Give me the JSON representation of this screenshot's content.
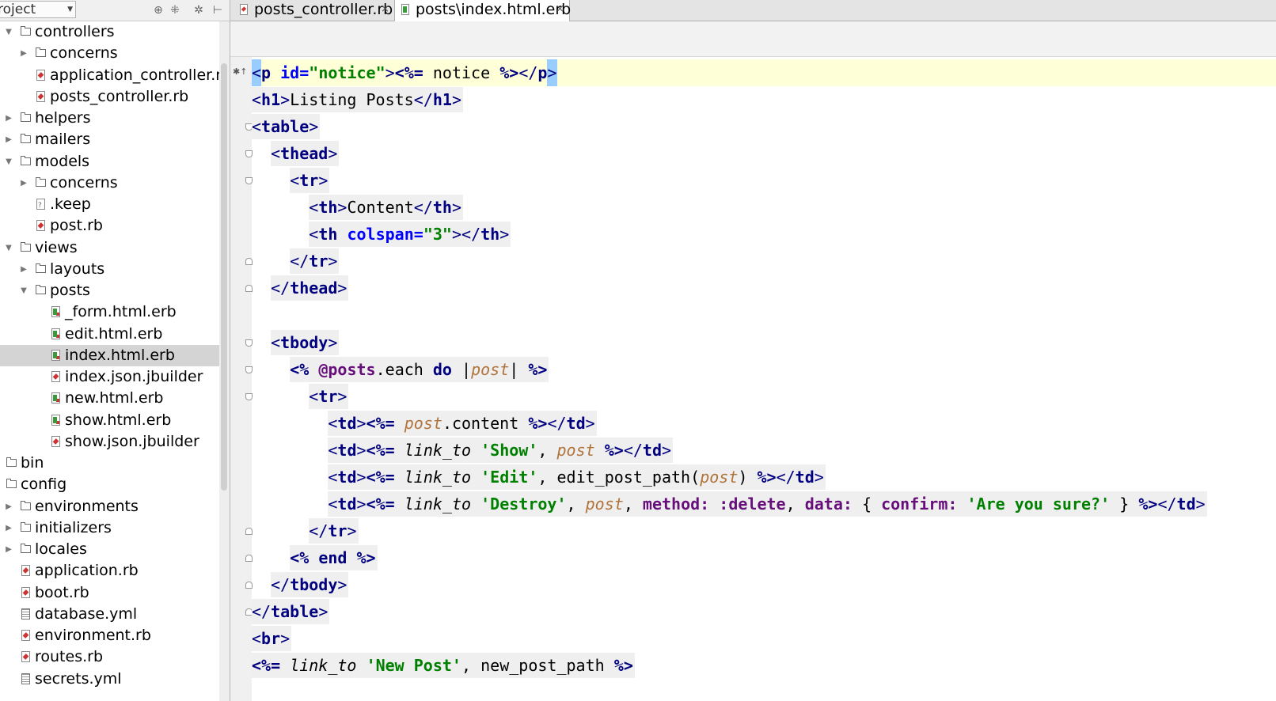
{
  "project_panel": {
    "combo_label": "roject",
    "tools": [
      {
        "icon": "target-icon",
        "glyph": "⊕"
      },
      {
        "icon": "collapse-icon",
        "glyph": "⁜"
      },
      {
        "icon": "gear-icon",
        "glyph": "✲"
      },
      {
        "icon": "hide-icon",
        "glyph": "⊢"
      }
    ]
  },
  "tree": [
    {
      "label": "controllers",
      "type": "folder",
      "depth": 0,
      "expanded": true
    },
    {
      "label": "concerns",
      "type": "folder",
      "depth": 1,
      "expanded": false
    },
    {
      "label": "application_controller.rb",
      "type": "rb",
      "depth": 1
    },
    {
      "label": "posts_controller.rb",
      "type": "rb",
      "depth": 1
    },
    {
      "label": "helpers",
      "type": "folder",
      "depth": 0,
      "expanded": false
    },
    {
      "label": "mailers",
      "type": "folder",
      "depth": 0,
      "expanded": false
    },
    {
      "label": "models",
      "type": "folder",
      "depth": 0,
      "expanded": true
    },
    {
      "label": "concerns",
      "type": "folder",
      "depth": 1,
      "expanded": false
    },
    {
      "label": ".keep",
      "type": "plain",
      "depth": 1
    },
    {
      "label": "post.rb",
      "type": "rb",
      "depth": 1
    },
    {
      "label": "views",
      "type": "folder",
      "depth": 0,
      "expanded": true
    },
    {
      "label": "layouts",
      "type": "folder",
      "depth": 1,
      "expanded": false
    },
    {
      "label": "posts",
      "type": "folder",
      "depth": 1,
      "expanded": true
    },
    {
      "label": "_form.html.erb",
      "type": "erb",
      "depth": 2
    },
    {
      "label": "edit.html.erb",
      "type": "erb",
      "depth": 2
    },
    {
      "label": "index.html.erb",
      "type": "erb",
      "depth": 2,
      "selected": true
    },
    {
      "label": "index.json.jbuilder",
      "type": "rb",
      "depth": 2
    },
    {
      "label": "new.html.erb",
      "type": "erb",
      "depth": 2
    },
    {
      "label": "show.html.erb",
      "type": "erb",
      "depth": 2
    },
    {
      "label": "show.json.jbuilder",
      "type": "rb",
      "depth": 2
    },
    {
      "label": "bin",
      "type": "folder",
      "depth": -1,
      "expanded": null
    },
    {
      "label": "config",
      "type": "folder",
      "depth": -1,
      "expanded": null
    },
    {
      "label": "environments",
      "type": "folder",
      "depth": 0,
      "expanded": false
    },
    {
      "label": "initializers",
      "type": "folder",
      "depth": 0,
      "expanded": false
    },
    {
      "label": "locales",
      "type": "folder",
      "depth": 0,
      "expanded": false
    },
    {
      "label": "application.rb",
      "type": "rb",
      "depth": 0
    },
    {
      "label": "boot.rb",
      "type": "rb",
      "depth": 0
    },
    {
      "label": "database.yml",
      "type": "yml",
      "depth": 0
    },
    {
      "label": "environment.rb",
      "type": "rb",
      "depth": 0
    },
    {
      "label": "routes.rb",
      "type": "rb",
      "depth": 0
    },
    {
      "label": "secrets.yml",
      "type": "yml",
      "depth": 0
    }
  ],
  "tabs": [
    {
      "label": "posts_controller.rb",
      "icon": "ruby-file-icon",
      "active": false
    },
    {
      "label": "posts\\index.html.erb",
      "icon": "erb-file-icon",
      "active": true
    }
  ],
  "tab_close_glyph": "×",
  "code_lines": [
    {
      "current": true,
      "tokens": [
        [
          "<",
          "bracket",
          "hl"
        ],
        [
          "p",
          "tag"
        ],
        [
          " id=",
          "attr"
        ],
        [
          "\"notice\"",
          "str"
        ],
        [
          ">",
          "bracket"
        ],
        [
          "<%=",
          "erb"
        ],
        [
          " notice ",
          "plain"
        ],
        [
          "%>",
          "erb"
        ],
        [
          "</",
          "bracket"
        ],
        [
          "p",
          "tag"
        ],
        [
          ">",
          "bracket",
          "hl"
        ]
      ]
    },
    {
      "tokens": [
        [
          "<",
          "bracket"
        ],
        [
          "h1",
          "tag"
        ],
        [
          ">",
          "bracket"
        ],
        [
          "Listing Posts",
          "text"
        ],
        [
          "</",
          "bracket"
        ],
        [
          "h1",
          "tag"
        ],
        [
          ">",
          "bracket"
        ]
      ]
    },
    {
      "tokens": [
        [
          "<",
          "bracket"
        ],
        [
          "table",
          "tag"
        ],
        [
          ">",
          "bracket"
        ]
      ]
    },
    {
      "tokens": [
        [
          "  ",
          "plain"
        ],
        [
          "<",
          "bracket"
        ],
        [
          "thead",
          "tag"
        ],
        [
          ">",
          "bracket"
        ]
      ]
    },
    {
      "tokens": [
        [
          "    ",
          "plain"
        ],
        [
          "<",
          "bracket"
        ],
        [
          "tr",
          "tag"
        ],
        [
          ">",
          "bracket"
        ]
      ]
    },
    {
      "tokens": [
        [
          "      ",
          "plain"
        ],
        [
          "<",
          "bracket"
        ],
        [
          "th",
          "tag"
        ],
        [
          ">",
          "bracket"
        ],
        [
          "Content",
          "text"
        ],
        [
          "</",
          "bracket"
        ],
        [
          "th",
          "tag"
        ],
        [
          ">",
          "bracket"
        ]
      ]
    },
    {
      "tokens": [
        [
          "      ",
          "plain"
        ],
        [
          "<",
          "bracket"
        ],
        [
          "th",
          "tag"
        ],
        [
          " colspan=",
          "attr"
        ],
        [
          "\"3\"",
          "str"
        ],
        [
          ">",
          "bracket"
        ],
        [
          "</",
          "bracket"
        ],
        [
          "th",
          "tag"
        ],
        [
          ">",
          "bracket"
        ]
      ]
    },
    {
      "tokens": [
        [
          "    ",
          "plain"
        ],
        [
          "</",
          "bracket"
        ],
        [
          "tr",
          "tag"
        ],
        [
          ">",
          "bracket"
        ]
      ]
    },
    {
      "tokens": [
        [
          "  ",
          "plain"
        ],
        [
          "</",
          "bracket"
        ],
        [
          "thead",
          "tag"
        ],
        [
          ">",
          "bracket"
        ]
      ]
    },
    {
      "tokens": []
    },
    {
      "tokens": [
        [
          "  ",
          "plain"
        ],
        [
          "<",
          "bracket"
        ],
        [
          "tbody",
          "tag"
        ],
        [
          ">",
          "bracket"
        ]
      ]
    },
    {
      "tokens": [
        [
          "    ",
          "plain"
        ],
        [
          "<%",
          "erb"
        ],
        [
          " ",
          "plain"
        ],
        [
          "@posts",
          "ivar"
        ],
        [
          ".each ",
          "plain"
        ],
        [
          "do",
          "kw"
        ],
        [
          " |",
          "plain"
        ],
        [
          "post",
          "var"
        ],
        [
          "| ",
          "plain"
        ],
        [
          "%>",
          "erb"
        ]
      ]
    },
    {
      "tokens": [
        [
          "      ",
          "plain"
        ],
        [
          "<",
          "bracket"
        ],
        [
          "tr",
          "tag"
        ],
        [
          ">",
          "bracket"
        ]
      ]
    },
    {
      "tokens": [
        [
          "        ",
          "plain"
        ],
        [
          "<",
          "bracket"
        ],
        [
          "td",
          "tag"
        ],
        [
          ">",
          "bracket"
        ],
        [
          "<%=",
          "erb"
        ],
        [
          " ",
          "plain"
        ],
        [
          "post",
          "var"
        ],
        [
          ".content ",
          "plain"
        ],
        [
          "%>",
          "erb"
        ],
        [
          "</",
          "bracket"
        ],
        [
          "td",
          "tag"
        ],
        [
          ">",
          "bracket"
        ]
      ]
    },
    {
      "tokens": [
        [
          "        ",
          "plain"
        ],
        [
          "<",
          "bracket"
        ],
        [
          "td",
          "tag"
        ],
        [
          ">",
          "bracket"
        ],
        [
          "<%=",
          "erb"
        ],
        [
          " ",
          "plain"
        ],
        [
          "link_to",
          "meth"
        ],
        [
          " ",
          "plain"
        ],
        [
          "'Show'",
          "rstr"
        ],
        [
          ", ",
          "plain"
        ],
        [
          "post",
          "var"
        ],
        [
          " ",
          "plain"
        ],
        [
          "%>",
          "erb"
        ],
        [
          "</",
          "bracket"
        ],
        [
          "td",
          "tag"
        ],
        [
          ">",
          "bracket"
        ]
      ]
    },
    {
      "tokens": [
        [
          "        ",
          "plain"
        ],
        [
          "<",
          "bracket"
        ],
        [
          "td",
          "tag"
        ],
        [
          ">",
          "bracket"
        ],
        [
          "<%=",
          "erb"
        ],
        [
          " ",
          "plain"
        ],
        [
          "link_to",
          "meth"
        ],
        [
          " ",
          "plain"
        ],
        [
          "'Edit'",
          "rstr"
        ],
        [
          ", edit_post_path(",
          "plain"
        ],
        [
          "post",
          "var"
        ],
        [
          ") ",
          "plain"
        ],
        [
          "%>",
          "erb"
        ],
        [
          "</",
          "bracket"
        ],
        [
          "td",
          "tag"
        ],
        [
          ">",
          "bracket"
        ]
      ]
    },
    {
      "tokens": [
        [
          "        ",
          "plain"
        ],
        [
          "<",
          "bracket"
        ],
        [
          "td",
          "tag"
        ],
        [
          ">",
          "bracket"
        ],
        [
          "<%=",
          "erb"
        ],
        [
          " ",
          "plain"
        ],
        [
          "link_to",
          "meth"
        ],
        [
          " ",
          "plain"
        ],
        [
          "'Destroy'",
          "rstr"
        ],
        [
          ", ",
          "plain"
        ],
        [
          "post",
          "var"
        ],
        [
          ", ",
          "plain"
        ],
        [
          "method:",
          "sym"
        ],
        [
          " ",
          "plain"
        ],
        [
          ":delete",
          "sym"
        ],
        [
          ", ",
          "plain"
        ],
        [
          "data:",
          "sym"
        ],
        [
          " { ",
          "plain"
        ],
        [
          "confirm:",
          "sym"
        ],
        [
          " ",
          "plain"
        ],
        [
          "'Are you sure?'",
          "rstr"
        ],
        [
          " } ",
          "plain"
        ],
        [
          "%>",
          "erb"
        ],
        [
          "</",
          "bracket"
        ],
        [
          "td",
          "tag"
        ],
        [
          ">",
          "bracket"
        ]
      ]
    },
    {
      "tokens": [
        [
          "      ",
          "plain"
        ],
        [
          "</",
          "bracket"
        ],
        [
          "tr",
          "tag"
        ],
        [
          ">",
          "bracket"
        ]
      ]
    },
    {
      "tokens": [
        [
          "    ",
          "plain"
        ],
        [
          "<%",
          "erb"
        ],
        [
          " ",
          "plain"
        ],
        [
          "end",
          "kw"
        ],
        [
          " ",
          "plain"
        ],
        [
          "%>",
          "erb"
        ]
      ]
    },
    {
      "tokens": [
        [
          "  ",
          "plain"
        ],
        [
          "</",
          "bracket"
        ],
        [
          "tbody",
          "tag"
        ],
        [
          ">",
          "bracket"
        ]
      ]
    },
    {
      "tokens": [
        [
          "</",
          "bracket"
        ],
        [
          "table",
          "tag"
        ],
        [
          ">",
          "bracket"
        ]
      ]
    },
    {
      "tokens": [
        [
          "<",
          "bracket"
        ],
        [
          "br",
          "tag"
        ],
        [
          ">",
          "bracket"
        ]
      ]
    },
    {
      "tokens": [
        [
          "<%=",
          "erb"
        ],
        [
          " ",
          "plain"
        ],
        [
          "link_to",
          "meth"
        ],
        [
          " ",
          "plain"
        ],
        [
          "'New Post'",
          "rstr"
        ],
        [
          ", new_post_path ",
          "plain"
        ],
        [
          "%>",
          "erb"
        ]
      ]
    }
  ],
  "fold_markers": [
    {
      "line": 2,
      "kind": "start"
    },
    {
      "line": 3,
      "kind": "start"
    },
    {
      "line": 4,
      "kind": "start"
    },
    {
      "line": 7,
      "kind": "end"
    },
    {
      "line": 8,
      "kind": "end"
    },
    {
      "line": 10,
      "kind": "start"
    },
    {
      "line": 11,
      "kind": "start"
    },
    {
      "line": 12,
      "kind": "start"
    },
    {
      "line": 17,
      "kind": "end"
    },
    {
      "line": 18,
      "kind": "end"
    },
    {
      "line": 19,
      "kind": "end"
    },
    {
      "line": 20,
      "kind": "end"
    }
  ],
  "colors": {
    "current_line": "#ffffd7",
    "selection": "#d4d4d4",
    "tag": "#000080",
    "string": "#008000",
    "variable": "#b0733a",
    "ivar": "#660e7a"
  }
}
